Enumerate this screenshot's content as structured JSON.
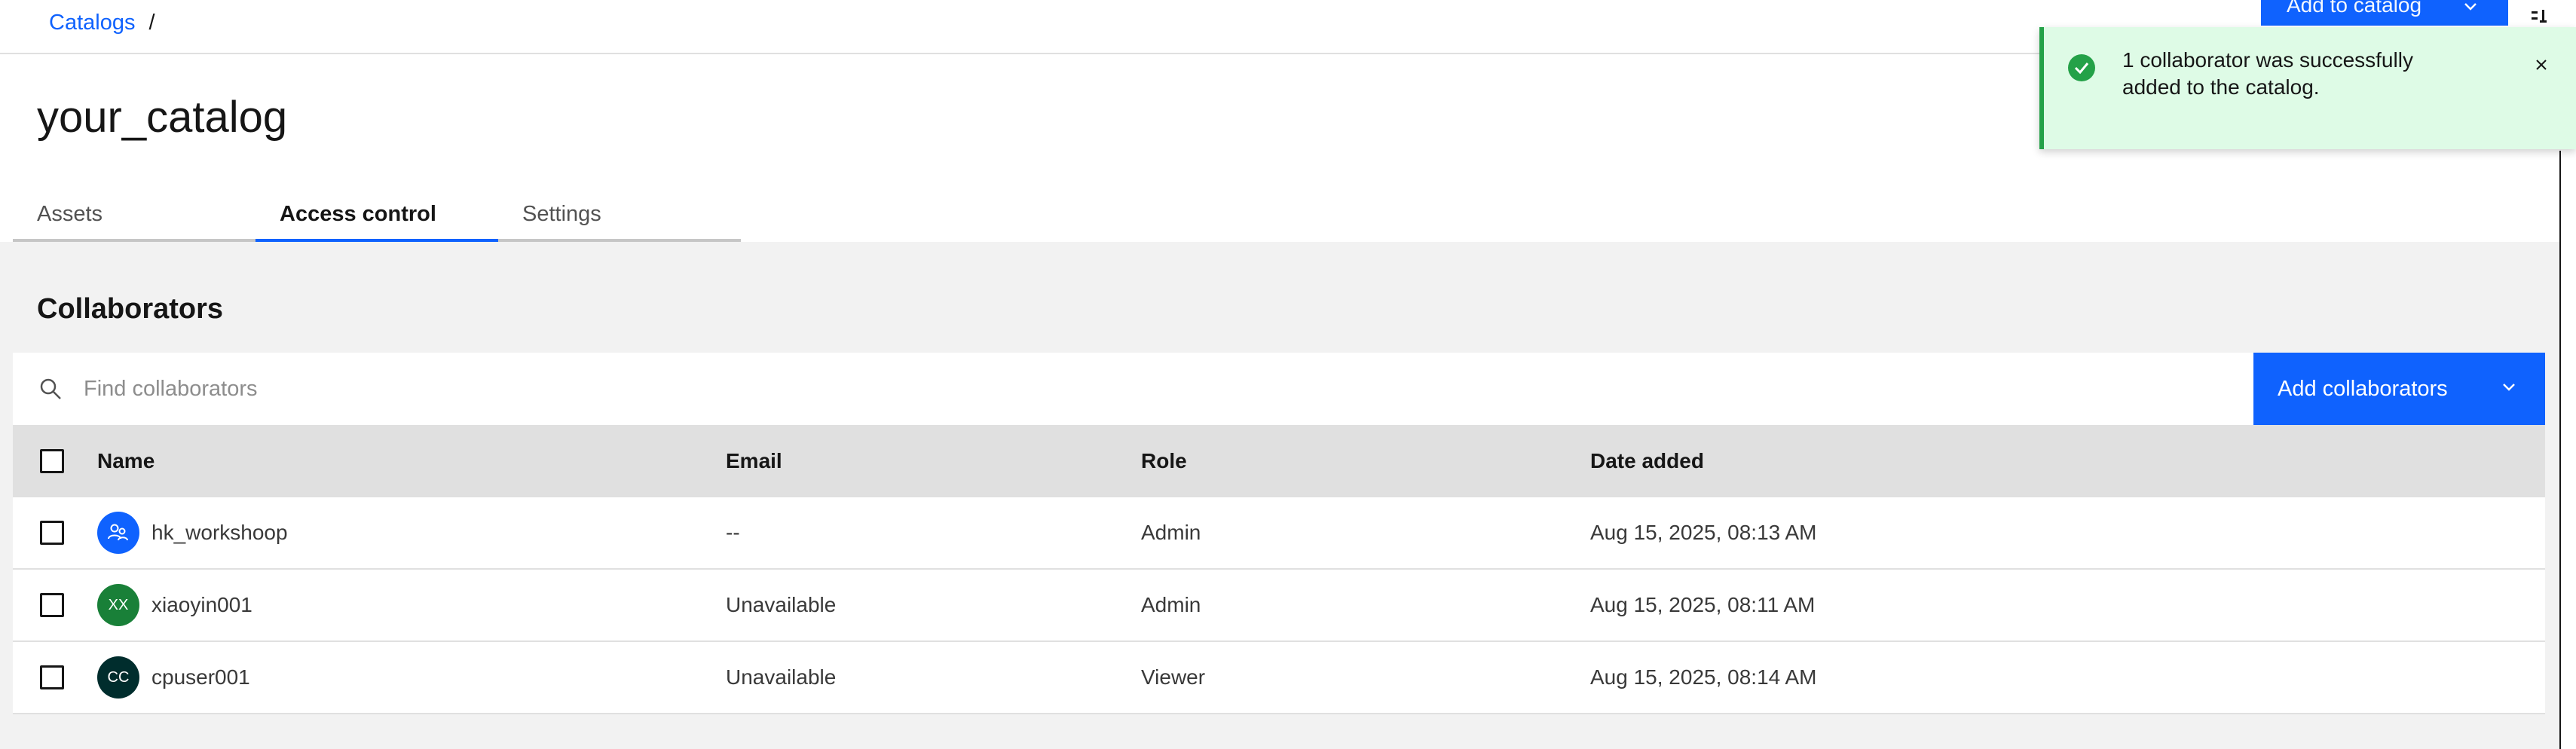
{
  "breadcrumb": {
    "link": "Catalogs",
    "separator": "/"
  },
  "header": {
    "add_to_catalog_label": "Add to catalog"
  },
  "page": {
    "title": "your_catalog"
  },
  "tabs": [
    {
      "label": "Assets",
      "active": false
    },
    {
      "label": "Access control",
      "active": true
    },
    {
      "label": "Settings",
      "active": false
    }
  ],
  "collaborators": {
    "section_title": "Collaborators",
    "search_placeholder": "Find collaborators",
    "add_button_label": "Add collaborators",
    "columns": {
      "name": "Name",
      "email": "Email",
      "role": "Role",
      "date": "Date added"
    },
    "rows": [
      {
        "avatar_type": "group-icon",
        "avatar_text": "",
        "avatar_color": "#0f62fe",
        "name": "hk_workshoop",
        "email": "--",
        "role": "Admin",
        "date": "Aug 15, 2025, 08:13 AM"
      },
      {
        "avatar_type": "initials",
        "avatar_text": "XX",
        "avatar_color": "#198038",
        "name": "xiaoyin001",
        "email": "Unavailable",
        "role": "Admin",
        "date": "Aug 15, 2025, 08:11 AM"
      },
      {
        "avatar_type": "initials",
        "avatar_text": "CC",
        "avatar_color": "#002d2d",
        "name": "cpuser001",
        "email": "Unavailable",
        "role": "Viewer",
        "date": "Aug 15, 2025, 08:14 AM"
      }
    ]
  },
  "toast": {
    "message_line1": "1 collaborator was successfully",
    "message_line2": "added to the catalog.",
    "status": "success"
  },
  "colors": {
    "primary": "#0f62fe",
    "success": "#24a148",
    "toast_bg": "#defbe6"
  }
}
